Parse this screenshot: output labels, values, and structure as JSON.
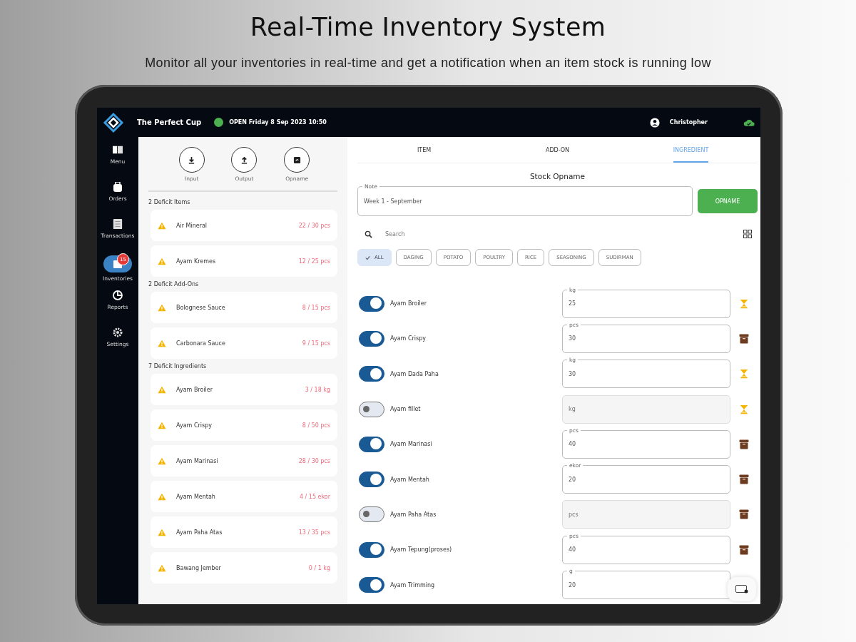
{
  "header": {
    "title": "Real-Time Inventory System",
    "subtitle": "Monitor all your inventories in real-time and get a notification when an item stock is running low"
  },
  "topbar": {
    "store": "The Perfect Cup",
    "status": "OPEN Friday 8 Sep 2023 10:50",
    "open": true,
    "user": "Christopher"
  },
  "sidebar": [
    {
      "label": "Menu",
      "kind": "menu",
      "selected": false
    },
    {
      "label": "Orders",
      "kind": "orders",
      "selected": false
    },
    {
      "label": "Transactions",
      "kind": "transactions",
      "selected": false
    },
    {
      "label": "Inventories",
      "kind": "inventories",
      "selected": true,
      "badge": "15"
    },
    {
      "label": "Reports",
      "kind": "reports",
      "selected": false
    },
    {
      "label": "Settings",
      "kind": "settings",
      "selected": false
    }
  ],
  "actions": [
    {
      "label": "Input",
      "kind": "input"
    },
    {
      "label": "Output",
      "kind": "output"
    },
    {
      "label": "Opname",
      "kind": "opname"
    }
  ],
  "deficits": [
    {
      "heading": "2 Deficit Items",
      "items": [
        {
          "name": "Air Mineral",
          "qty": "22 / 30 pcs"
        },
        {
          "name": "Ayam Kremes",
          "qty": "12 / 25 pcs"
        }
      ]
    },
    {
      "heading": "2 Deficit Add-Ons",
      "items": [
        {
          "name": "Bolognese Sauce",
          "qty": "8 / 15 pcs"
        },
        {
          "name": "Carbonara Sauce",
          "qty": "9 / 15 pcs"
        }
      ]
    },
    {
      "heading": "7 Deficit Ingredients",
      "items": [
        {
          "name": "Ayam Broiler",
          "qty": "3 / 18 kg"
        },
        {
          "name": "Ayam Crispy",
          "qty": "8 / 50 pcs"
        },
        {
          "name": "Ayam Marinasi",
          "qty": "28 / 30 pcs"
        },
        {
          "name": "Ayam Mentah",
          "qty": "4 / 15 ekor"
        },
        {
          "name": "Ayam Paha Atas",
          "qty": "13 / 35 pcs"
        },
        {
          "name": "Bawang Jember",
          "qty": "0 / 1 kg"
        }
      ]
    }
  ],
  "tabs": [
    {
      "label": "ITEM",
      "selected": false
    },
    {
      "label": "ADD-ON",
      "selected": false
    },
    {
      "label": "INGREDIENT",
      "selected": true
    }
  ],
  "form_title": "Stock Opname",
  "note": {
    "label": "Note",
    "value": "Week 1 - September"
  },
  "opname_button": "OPNAME",
  "search": {
    "placeholder": "Search"
  },
  "chips": [
    {
      "label": "ALL",
      "selected": true
    },
    {
      "label": "DAGING",
      "selected": false
    },
    {
      "label": "POTATO",
      "selected": false
    },
    {
      "label": "POULTRY",
      "selected": false
    },
    {
      "label": "RICE",
      "selected": false
    },
    {
      "label": "SEASONING",
      "selected": false
    },
    {
      "label": "SUDIRMAN",
      "selected": false
    }
  ],
  "ingredients": [
    {
      "name": "Ayam Broiler",
      "on": true,
      "unit": "kg",
      "value": "25",
      "kind": "hourglass"
    },
    {
      "name": "Ayam Crispy",
      "on": true,
      "unit": "pcs",
      "value": "30",
      "kind": "box"
    },
    {
      "name": "Ayam Dada Paha",
      "on": true,
      "unit": "kg",
      "value": "30",
      "kind": "hourglass"
    },
    {
      "name": "Ayam fillet",
      "on": false,
      "placeholder": "kg",
      "kind": "hourglass"
    },
    {
      "name": "Ayam Marinasi",
      "on": true,
      "unit": "pcs",
      "value": "40",
      "kind": "box"
    },
    {
      "name": "Ayam Mentah",
      "on": true,
      "unit": "ekor",
      "value": "20",
      "kind": "box"
    },
    {
      "name": "Ayam Paha Atas",
      "on": false,
      "placeholder": "pcs",
      "kind": "box"
    },
    {
      "name": "Ayam Tepung(proses)",
      "on": true,
      "unit": "pcs",
      "value": "40",
      "kind": "box"
    },
    {
      "name": "Ayam Trimming",
      "on": true,
      "unit": "g",
      "value": "20",
      "kind": "none"
    }
  ]
}
